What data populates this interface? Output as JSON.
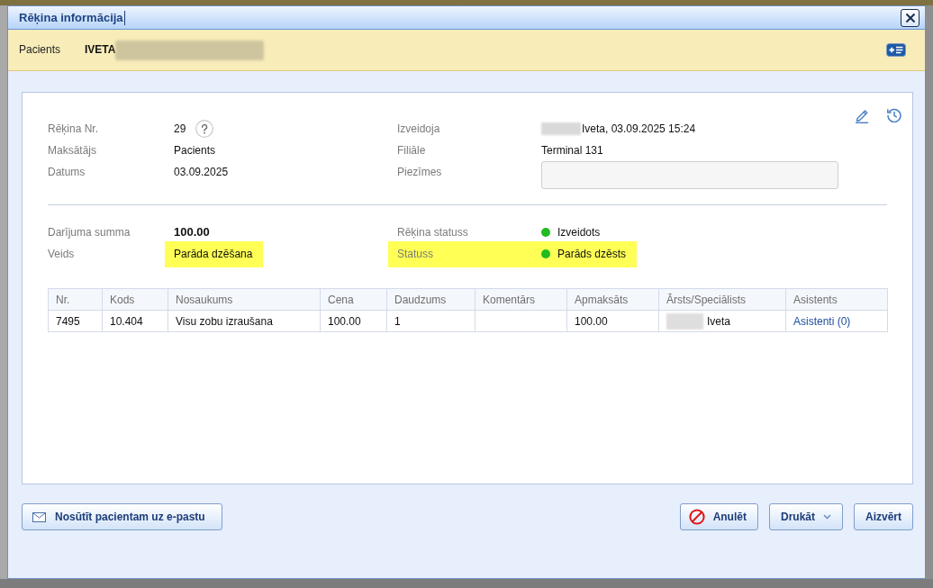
{
  "window": {
    "title": "Rēķina informācija"
  },
  "patient_bar": {
    "label": "Pacients",
    "name": "IVETA",
    "redacted": true
  },
  "details": {
    "left": [
      {
        "kind": "help",
        "label": "Rēķina Nr.",
        "value": "29"
      },
      {
        "kind": "text",
        "label": "Maksātājs",
        "value": "Pacients"
      },
      {
        "kind": "text",
        "label": "Datums",
        "value": "03.09.2025"
      }
    ],
    "right": [
      {
        "kind": "text",
        "label": "Izveidoja",
        "value": "Iveta, 03.09.2025 15:24",
        "redacted": true
      },
      {
        "kind": "text",
        "label": "Filiāle",
        "value": "Terminal 131"
      },
      {
        "kind": "textarea",
        "label": "Piezīmes"
      }
    ]
  },
  "summary": {
    "left": [
      {
        "kind": "amount",
        "label": "Darījuma summa",
        "value": "100.00",
        "label_highlighted": false,
        "value_highlighted": false
      },
      {
        "kind": "text",
        "label": "Veids",
        "value": "Parāda dzēšana",
        "label_highlighted": false,
        "value_highlighted": true
      }
    ],
    "right": [
      {
        "kind": "status",
        "label": "Rēķina statuss",
        "value": "Izveidots",
        "color": "#22bb22",
        "label_highlighted": false,
        "value_highlighted": false
      },
      {
        "kind": "status",
        "label": "Statuss",
        "value": "Parāds dzēsts",
        "color": "#22bb22",
        "label_highlighted": true,
        "value_highlighted": true
      }
    ]
  },
  "table": {
    "columns": [
      "Nr.",
      "Kods",
      "Nosaukums",
      "Cena",
      "Daudzums",
      "Komentārs",
      "Apmaksāts",
      "Ārsts/Speciālists",
      "Asistents"
    ],
    "rows": [
      {
        "cells": [
          {
            "kind": "text",
            "text": "7495"
          },
          {
            "kind": "text",
            "text": "10.404"
          },
          {
            "kind": "text",
            "text": "Visu zobu izraušana"
          },
          {
            "kind": "text",
            "text": "100.00"
          },
          {
            "kind": "text",
            "text": "1"
          },
          {
            "kind": "empty"
          },
          {
            "kind": "text",
            "text": "100.00"
          },
          {
            "kind": "text",
            "text": "Iveta",
            "redacted": true
          },
          {
            "kind": "link",
            "text": "Asistenti (0)"
          }
        ]
      }
    ]
  },
  "footer": {
    "left": [
      {
        "kind": "mail",
        "label": "Nosūtīt pacientam uz e-pastu"
      }
    ],
    "right": [
      {
        "kind": "cancel",
        "label": "Anulēt"
      },
      {
        "kind": "dropdown",
        "label": "Drukāt"
      },
      {
        "kind": "plain",
        "label": "Aizvērt"
      }
    ]
  }
}
